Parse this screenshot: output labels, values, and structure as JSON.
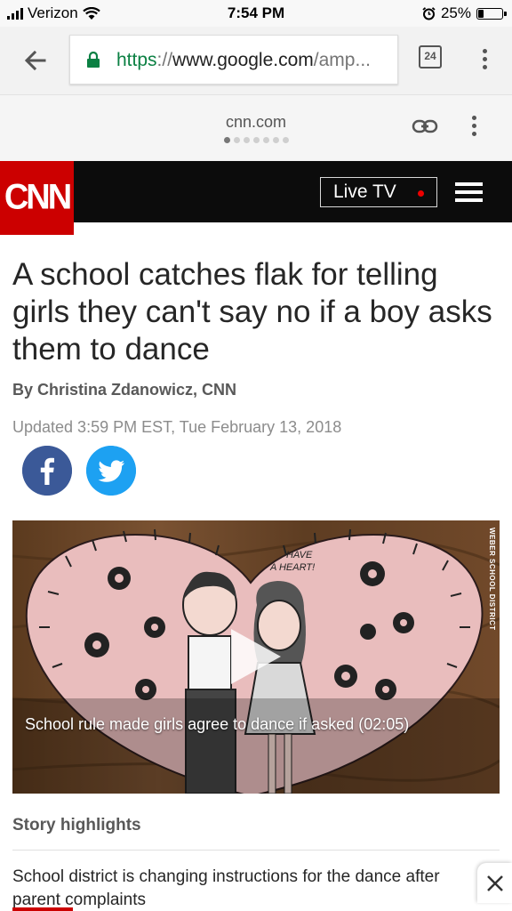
{
  "status_bar": {
    "carrier": "Verizon",
    "time": "7:54 PM",
    "battery_percent": "25%",
    "battery_level": 0.25,
    "icons": [
      "signal-bars-icon",
      "wifi-icon",
      "alarm-icon",
      "battery-icon"
    ]
  },
  "browser": {
    "url_scheme": "https",
    "url_separator": "://",
    "url_host": "www.google.com",
    "url_rest": "/amp...",
    "tab_count": "24",
    "secure_color": "#0b8043"
  },
  "amp": {
    "domain": "cnn.com",
    "page_dots": 7,
    "active_dot": 0
  },
  "cnn_header": {
    "logo_text": "CNN",
    "live_tv_label": "Live TV",
    "brand_color": "#cc0000"
  },
  "article": {
    "headline": "A school catches flak for telling girls they can't say no if a boy asks them to dance",
    "byline": "By Christina Zdanowicz, CNN",
    "updated": "Updated 3:59 PM EST, Tue February 13, 2018",
    "share": [
      "facebook-icon",
      "twitter-icon"
    ]
  },
  "video": {
    "caption": "School rule made girls agree to dance if asked (02:05)",
    "watermark": "WEBER SCHOOL DISTRICT",
    "heart_text_1": "HAVE",
    "heart_text_2": "A HEART!"
  },
  "highlights": {
    "title": "Story highlights",
    "items": [
      "School district is changing instructions for the dance after parent complaints"
    ]
  }
}
